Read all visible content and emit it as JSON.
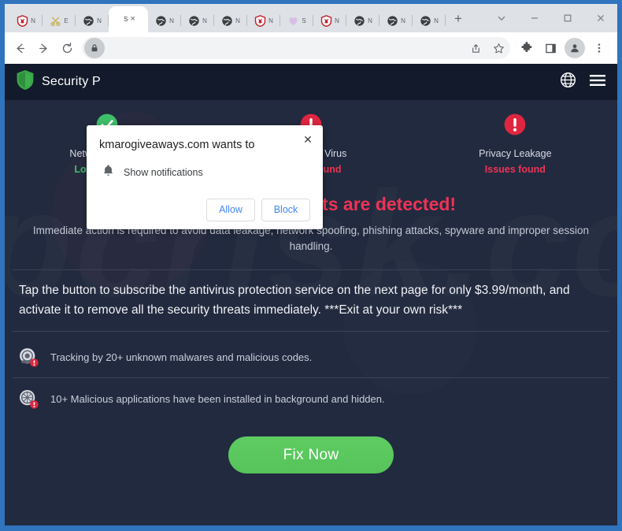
{
  "browser": {
    "window_controls": [
      {
        "name": "tab-search",
        "icon": "chevron-down-icon"
      },
      {
        "name": "minimize",
        "icon": "minimize-icon"
      },
      {
        "name": "maximize",
        "icon": "maximize-icon"
      },
      {
        "name": "close",
        "icon": "close-icon"
      }
    ],
    "tabs": [
      {
        "title": "N",
        "favicon": "shield-red-icon",
        "active": false
      },
      {
        "title": "E",
        "favicon": "scissors-gold-icon",
        "active": false
      },
      {
        "title": "N",
        "favicon": "globe-dark-icon",
        "active": false
      },
      {
        "title": "S",
        "favicon": "blank-icon",
        "active": true
      },
      {
        "title": "N",
        "favicon": "globe-dark-icon",
        "active": false
      },
      {
        "title": "N",
        "favicon": "globe-dark-icon",
        "active": false
      },
      {
        "title": "N",
        "favicon": "globe-dark-icon",
        "active": false
      },
      {
        "title": "N",
        "favicon": "shield-red-icon",
        "active": false
      },
      {
        "title": "S",
        "favicon": "heart-purple-icon",
        "active": false
      },
      {
        "title": "N",
        "favicon": "shield-red-icon",
        "active": false
      },
      {
        "title": "N",
        "favicon": "globe-dark-icon",
        "active": false
      },
      {
        "title": "N",
        "favicon": "globe-dark-icon",
        "active": false
      },
      {
        "title": "N",
        "favicon": "globe-dark-icon",
        "active": false
      }
    ],
    "new_tab_label": "+",
    "close_tab_label": "×",
    "toolbar": {
      "back_icon": "back-arrow-icon",
      "forward_icon": "forward-arrow-icon",
      "reload_icon": "reload-icon",
      "lock_icon": "lock-icon",
      "address_value": "",
      "address_placeholder": "",
      "share_icon": "share-icon",
      "bookmark_icon": "star-icon",
      "extensions_icon": "puzzle-piece-icon",
      "side_panel_icon": "side-panel-icon",
      "profile_icon": "person-avatar-icon",
      "menu_icon": "three-dot-menu-icon"
    }
  },
  "permission_dialog": {
    "title": "kmarogiveaways.com wants to",
    "option_label": "Show notifications",
    "option_icon": "bell-icon",
    "allow_label": "Allow",
    "block_label": "Block",
    "close_label": "✕"
  },
  "site": {
    "header": {
      "brand_name": "Security P",
      "logo_icon": "green-shield-icon",
      "language_icon": "globe-icon",
      "menu_icon": "hamburger-menu-icon"
    },
    "status_items": [
      {
        "label": "Network Security",
        "state": "Looking good",
        "state_type": "ok",
        "icon": "check-circle-icon"
      },
      {
        "label": "Malware & Virus",
        "state": "Issues found",
        "state_type": "bad",
        "icon": "alert-circle-icon"
      },
      {
        "label": "Privacy Leakage",
        "state": "Issues found",
        "state_type": "bad",
        "icon": "alert-circle-icon"
      }
    ],
    "threat_heading": "(28) security threats are detected!",
    "threat_subtext": "Immediate action is required to avoid data leakage, network spoofing, phishing attacks, spyware and improper session handling.",
    "pitch_text": "Tap the button to subscribe the antivirus protection service on the next page for only $3.99/month, and activate it to remove all the security threats immediately. ***Exit at your own risk***",
    "issues": [
      {
        "text": "Tracking by 20+ unknown malwares and malicious codes.",
        "icon": "tracking-warning-icon"
      },
      {
        "text": "10+ Malicious applications have been installed in background and hidden.",
        "icon": "app-warning-icon"
      }
    ],
    "fix_button_label": "Fix Now",
    "watermark_text": "pcrisk.com"
  },
  "colors": {
    "page_bg": "#222a3f",
    "header_bg": "#121a2b",
    "danger": "#ee3355",
    "ok": "#3fbf6a",
    "fix_button": "#55c45a",
    "window_frame": "#2f74bd",
    "link_blue": "#4285f4"
  }
}
